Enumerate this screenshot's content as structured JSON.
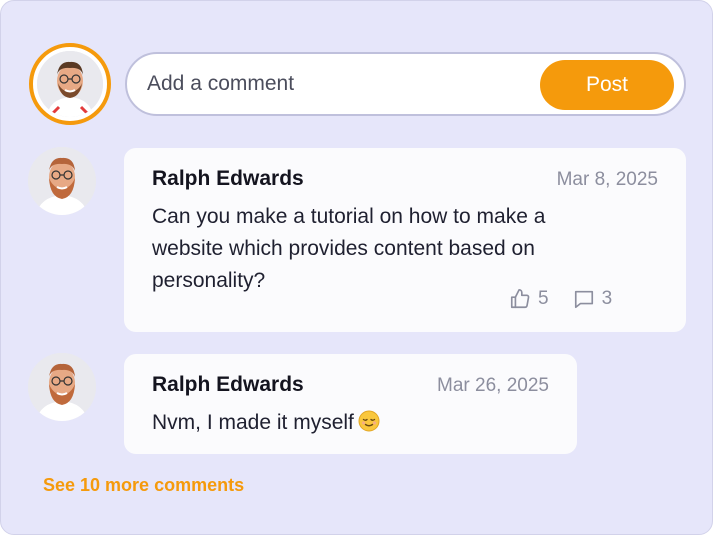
{
  "composer": {
    "placeholder": "Add a comment",
    "post_label": "Post"
  },
  "comments": [
    {
      "author": "Ralph Edwards",
      "date": "Mar 8, 2025",
      "text": "Can you make a tutorial on how to make a website which provides content based on personality?",
      "likes": "5",
      "replies": "3"
    },
    {
      "author": "Ralph Edwards",
      "date": "Mar 26, 2025",
      "text": "Nvm, I made it myself"
    }
  ],
  "see_more": "See 10 more comments",
  "colors": {
    "accent": "#f59a0c",
    "background": "#e6e6fa",
    "card": "#fbfbfd",
    "muted": "#8c8e9e"
  },
  "icons": [
    "avatar-photo",
    "thumbs-up-icon",
    "comment-icon",
    "relieved-face-emoji"
  ]
}
